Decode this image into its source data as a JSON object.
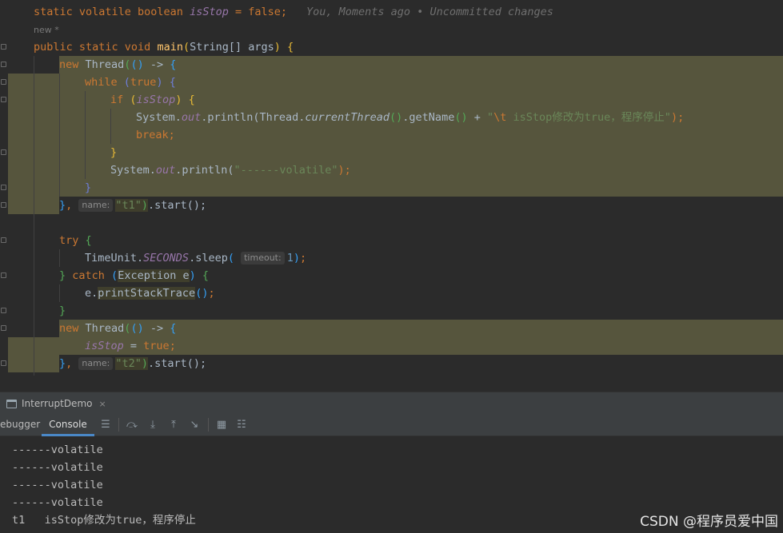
{
  "editor": {
    "line_field": {
      "code": "static volatile boolean ",
      "name": "isStop",
      "rest": " = false;",
      "blame": "You, Moments ago • Uncommitted changes"
    },
    "new_tag": "new *",
    "line_main": {
      "mods": "public static void ",
      "name": "main",
      "params": "String[] args",
      "brace": " {"
    },
    "line_thread1": {
      "kw": "new ",
      "cls": "Thread",
      "arrow": " -> "
    },
    "kw_while": "while ",
    "kw_true": "true",
    "kw_if": "if ",
    "field_isStop": "isStop",
    "line_println1": {
      "sys": "System.",
      "out": "out",
      "call": ".println(",
      "thread": "Thread.",
      "current": "currentThread",
      "getname": ".getName",
      "plus": " + ",
      "str_a": "\"",
      "esc": "\\t",
      "str_b": " isStop修改为true，程序停止\"",
      "end": ");"
    },
    "kw_break": "break;",
    "line_println2": {
      "sys": "System.",
      "out": "out",
      "call": ".println(",
      "str": "\"------volatile\"",
      "end": ");"
    },
    "line_t1_end": {
      "hint": "name:",
      "str": "\"t1\"",
      "start": ".start();"
    },
    "kw_try": "try ",
    "line_sleep": {
      "cls": "TimeUnit.",
      "unit": "SECONDS",
      "call": ".sleep",
      "hint": "timeout:",
      "num": "1",
      "end": ";"
    },
    "line_catch": {
      "kw": "catch ",
      "exc": "Exception e"
    },
    "line_trace": {
      "obj": "e.",
      "method": "printStackTrace",
      "end": ";"
    },
    "line_thread2": {
      "kw": "new ",
      "cls": "Thread",
      "arrow": " -> "
    },
    "line_assign": {
      "name": "isStop",
      "eq": " = ",
      "val": "true",
      "end": ";"
    },
    "line_t2_end": {
      "hint": "name:",
      "str": "\"t2\"",
      "start": ".start();"
    }
  },
  "run_window": {
    "tab_label": "InterruptDemo",
    "close": "×"
  },
  "tool_tabs": {
    "debugger": "ebugger",
    "console": "Console"
  },
  "toolbar_icons": [
    "menu-icon",
    "step-over-icon",
    "step-into-icon",
    "step-out-icon",
    "run-to-cursor-icon",
    "evaluate-icon",
    "trace-icon"
  ],
  "console_output": [
    "------volatile",
    "------volatile",
    "------volatile",
    "------volatile",
    "t1   isStop修改为true，程序停止"
  ],
  "watermark": "CSDN @程序员爱中国",
  "colors": {
    "keyword": "#cc7832",
    "string": "#6a8759",
    "field": "#9876aa",
    "method": "#ffc66d",
    "number": "#6897bb",
    "highlight": "#56553d",
    "console_text": "#bbbbbb",
    "tab_underline": "#4a88c7"
  }
}
